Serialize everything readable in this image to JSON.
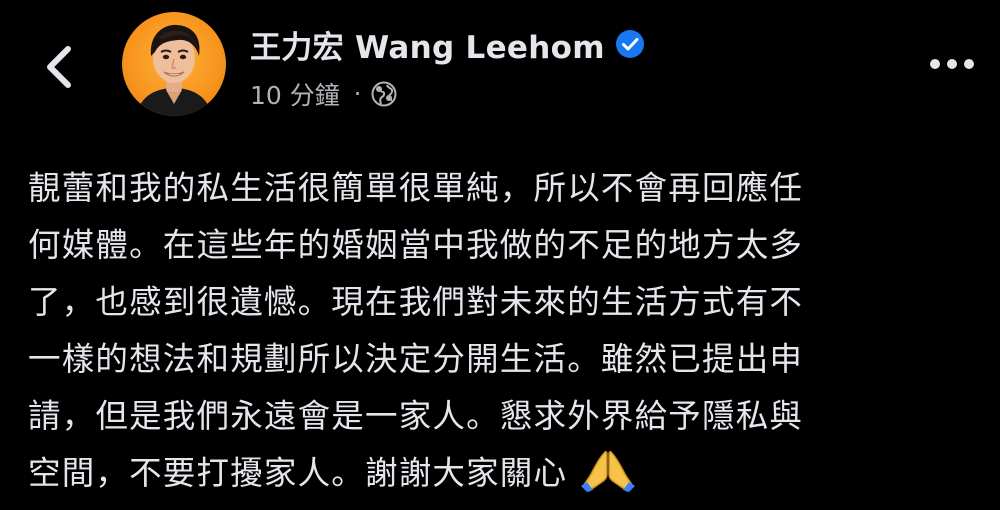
{
  "header": {
    "author_name": "王力宏 Wang Leehom",
    "timestamp": "10 分鐘",
    "meta_separator": "·",
    "verified": true,
    "privacy_icon": "globe-icon",
    "back_icon": "chevron-left-icon",
    "more_icon": "more-horizontal-icon"
  },
  "post": {
    "lines": [
      "靚蕾和我的私生活很簡單很單純，所以不會再回應任",
      "何媒體。在這些年的婚姻當中我做的不足的地方太多",
      "了，也感到很遺憾。現在我們對未來的生活方式有不",
      "一樣的想法和規劃所以決定分開生活。雖然已提出申",
      "請，但是我們永遠會是一家人。懇求外界給予隱私與",
      "空間，不要打擾家人。謝謝大家關心"
    ],
    "trailing_emoji": "folded-hands-emoji"
  },
  "colors": {
    "background": "#000000",
    "primary_text": "#e4e6eb",
    "secondary_text": "#b0b3b8",
    "verified_blue": "#1877f2",
    "avatar_bg": "#f7941d"
  }
}
